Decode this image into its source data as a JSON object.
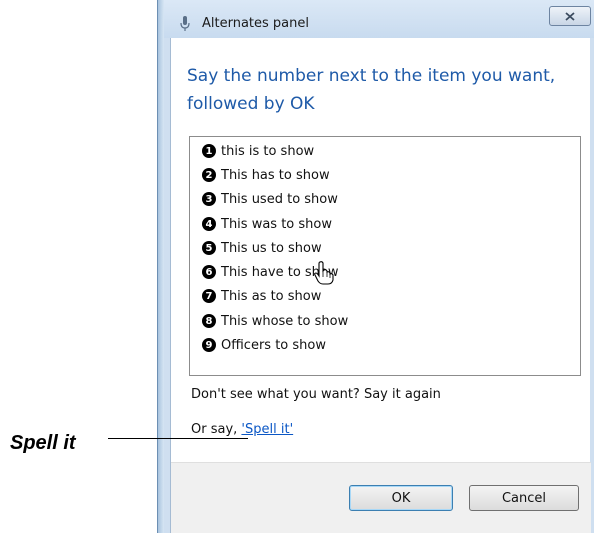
{
  "window": {
    "title": "Alternates panel",
    "close_symbol": "X"
  },
  "prompt": "Say the number next to the item you want, followed by OK",
  "alternates": [
    {
      "number": "1",
      "text": "this is to show"
    },
    {
      "number": "2",
      "text": "This has to show"
    },
    {
      "number": "3",
      "text": "This used to show"
    },
    {
      "number": "4",
      "text": "This was to show"
    },
    {
      "number": "5",
      "text": "This us to show"
    },
    {
      "number": "6",
      "text": "This have to show"
    },
    {
      "number": "7",
      "text": "This as to show"
    },
    {
      "number": "8",
      "text": "This whose to show"
    },
    {
      "number": "9",
      "text": "Officers to show"
    }
  ],
  "hint": "Don't see what you want? Say it again",
  "or_say": {
    "prefix": "Or say, ",
    "link": "'Spell it'"
  },
  "buttons": {
    "ok": "OK",
    "cancel": "Cancel"
  },
  "callout": {
    "label": "Spell it"
  },
  "icons": {
    "title_icon": "microphone-icon",
    "pointer": "hand-pointer-icon"
  }
}
